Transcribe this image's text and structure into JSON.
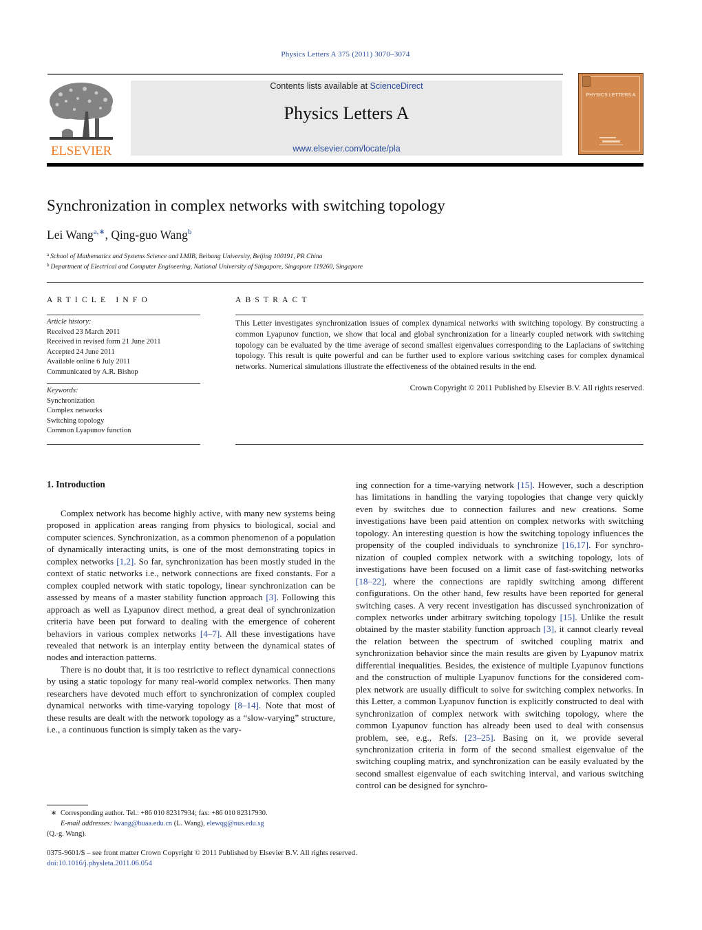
{
  "header": {
    "journal_reference": "Physics Letters A 375 (2011) 3070–3074",
    "contents_prefix": "Contents lists available at ",
    "contents_link": "ScienceDirect",
    "journal_title": "Physics Letters A",
    "journal_url": "www.elsevier.com/locate/pla",
    "publisher_logo_text": "ELSEVIER",
    "cover_title": "PHYSICS LETTERS A",
    "colors": {
      "link": "#2a4b9b",
      "elsevier_orange": "#f07a1f",
      "cover": "#d48a4e",
      "masthead_bg": "#e9e9e9"
    }
  },
  "article": {
    "title": "Synchronization in complex networks with switching topology",
    "authors": [
      {
        "name": "Lei Wang",
        "marks": "a,∗"
      },
      {
        "name": "Qing-guo Wang",
        "marks": "b"
      }
    ],
    "author_separator": ", ",
    "affiliations": [
      {
        "mark": "a",
        "text": "School of Mathematics and Systems Science and LMIB, Beihang University, Beijing 100191, PR China"
      },
      {
        "mark": "b",
        "text": "Department of Electrical and Computer Engineering, National University of Singapore, Singapore 119260, Singapore"
      }
    ]
  },
  "article_info": {
    "heading": "ARTICLE INFO",
    "history_label": "Article history:",
    "history": [
      "Received 23 March 2011",
      "Received in revised form 21 June 2011",
      "Accepted 24 June 2011",
      "Available online 6 July 2011",
      "Communicated by A.R. Bishop"
    ],
    "keywords_label": "Keywords:",
    "keywords": [
      "Synchronization",
      "Complex networks",
      "Switching topology",
      "Common Lyapunov function"
    ]
  },
  "abstract": {
    "heading": "ABSTRACT",
    "text": "This Letter investigates synchronization issues of complex dynamical networks with switching topology. By constructing a common Lyapunov function, we show that local and global synchronization for a linearly coupled network with switching topology can be evaluated by the time average of second smallest eigenvalues corresponding to the Laplacians of switching topology. This result is quite powerful and can be further used to explore various switching cases for complex dynamical networks. Numerical simulations illustrate the effectiveness of the obtained results in the end.",
    "copyright": "Crown Copyright © 2011 Published by Elsevier B.V. All rights reserved."
  },
  "body": {
    "section_heading": "1.  Introduction",
    "left_column": {
      "p1": {
        "t1": "Complex network has become highly active, with many new systems being proposed in application areas ranging from physics to biological, social and computer sciences. Synchronization, as a common phenomenon of a population of dynamically interact­ing units, is one of the most demonstrating topics in complex networks ",
        "c1": "[1,2]",
        "t2": ". So far, synchronization has been mostly stud­ed in the context of static networks i.e., network connections are fixed constants. For a complex coupled network with static topology, linear synchronization can be assessed by means of a master stability function approach ",
        "c2": "[3]",
        "t3": ". Following this approach as well as Lyapunov direct method, a great deal of synchroniza­tion criteria have been put forward to dealing with the emer­gence of coherent behaviors in various complex networks ",
        "c3": "[4–7]",
        "t4": ". All these investigations have revealed that network is an interplay entity between the dynamical states of nodes and interaction pat­terns."
      },
      "p2": {
        "t1": "There is no doubt that, it is too restrictive to reflect dynam­ical connections by using a static topology for many real-world complex networks. Then many researchers have devoted much ef­fort to synchronization of complex coupled dynamical networks with time-varying topology ",
        "c1": "[8–14]",
        "t2": ". Note that most of these re­sults are dealt with the network topology as a “slow-varying” structure, i.e., a continuous function is simply taken as the vary-"
      }
    },
    "right_column": {
      "t1": "ing connection for a time-varying network ",
      "c1": "[15]",
      "t2": ". However, such a description has limitations in handling the varying topologies that change very quickly even by switches due to connection fail­ures and new creations. Some investigations have been paid atten­tion on complex networks with switching topology. An interesting question is how the switching topology influences the propensity of the coupled individuals to synchronize ",
      "c2": "[16,17]",
      "t3": ". For synchro­nization of coupled complex network with a switching topology, lots of investigations have been focused on a limit case of fast-switching networks ",
      "c3": "[18–22]",
      "t4": ", where the connections are rapidly switching among different configurations. On the other hand, few results have been reported for general switching cases. A very re­cent investigation has discussed synchronization of complex net­works under arbitrary switching topology ",
      "c4": "[15]",
      "t5": ". Unlike the result obtained by the master stability function approach ",
      "c5": "[3]",
      "t6": ", it can­not clearly reveal the relation between the spectrum of switched coupling matrix and synchronization behavior since the main re­sults are given by Lyapunov matrix differential inequalities. Be­sides, the existence of multiple Lyapunov functions and the con­struction of multiple Lyapunov functions for the considered com­plex network are usually difficult to solve for switching complex networks. In this Letter, a common Lyapunov function is explic­itly constructed to deal with synchronization of complex network with switching topology, where the common Lyapunov function has already been used to deal with consensus problem, see, e.g., Refs. ",
      "c6": "[23–25]",
      "t7": ". Basing on it, we provide several synchronization criteria in form of the second smallest eigenvalue of the switch­ing coupling matrix, and synchronization can be easily evalu­ated by the second smallest eigenvalue of each switching inter­val, and various switching control can be designed for synchro-"
    }
  },
  "footnote": {
    "marker": "∗",
    "corresponding": "Corresponding author. Tel.: +86 010 82317934; fax: +86 010 82317930.",
    "email_label": "E-mail addresses:",
    "email1": "lwang@buaa.edu.cn",
    "email1_owner": " (L. Wang), ",
    "email2": "elewqg@nus.edu.sg",
    "email2_owner": "(Q.-g. Wang)."
  },
  "front_matter": {
    "issn_line": "0375-9601/$ – see front matter  Crown Copyright © 2011 Published by Elsevier B.V. All rights reserved.",
    "doi": "doi:10.1016/j.physleta.2011.06.054"
  }
}
